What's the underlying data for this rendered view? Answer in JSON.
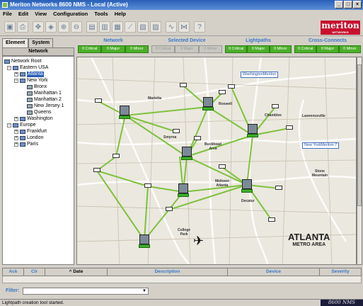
{
  "window": {
    "title": "Meriton Networks 8600 NMS - Local (Active)",
    "min": "_",
    "max": "□",
    "close": "×"
  },
  "menu": [
    "File",
    "Edit",
    "View",
    "Configuration",
    "Tools",
    "Help"
  ],
  "logo": {
    "text": "meriton",
    "sub": "NETWORKS"
  },
  "tabs": [
    "Element",
    "System"
  ],
  "tree": {
    "header": "Network",
    "nodes": [
      {
        "label": "Network Root",
        "level": 0,
        "exp": ""
      },
      {
        "label": "Eastern USA",
        "level": 1,
        "exp": "−"
      },
      {
        "label": "Atlanta",
        "level": 2,
        "exp": "+",
        "selected": true
      },
      {
        "label": "New York",
        "level": 2,
        "exp": "−"
      },
      {
        "label": "Bronx",
        "level": 3,
        "exp": ""
      },
      {
        "label": "Manhattan 1",
        "level": 3,
        "exp": ""
      },
      {
        "label": "Manhattan 2",
        "level": 3,
        "exp": ""
      },
      {
        "label": "New Jersey 1",
        "level": 3,
        "exp": ""
      },
      {
        "label": "Queens",
        "level": 3,
        "exp": ""
      },
      {
        "label": "Washington",
        "level": 2,
        "exp": "+"
      },
      {
        "label": "Europe",
        "level": 1,
        "exp": "−"
      },
      {
        "label": "Frankfurt",
        "level": 2,
        "exp": "+"
      },
      {
        "label": "London",
        "level": 2,
        "exp": "+"
      },
      {
        "label": "Paris",
        "level": 2,
        "exp": "+"
      }
    ]
  },
  "status_panels": [
    {
      "title": "Network",
      "boxes": [
        "0 Critical",
        "0 Major",
        "0 Minor"
      ],
      "gray": false
    },
    {
      "title": "Selected Device",
      "boxes": [
        "0 Critical",
        "0 Major",
        "0 Minor"
      ],
      "gray": true
    },
    {
      "title": "Lightpaths",
      "boxes": [
        "0 Critical",
        "0 Major",
        "0 Minor"
      ],
      "gray": false
    },
    {
      "title": "Cross-Connects",
      "boxes": [
        "0 Critical",
        "0 Major",
        "0 Minor"
      ],
      "gray": false
    }
  ],
  "map": {
    "places": [
      {
        "label": "Marietta"
      },
      {
        "label": "Roswell"
      },
      {
        "label": "Smyrna"
      },
      {
        "label": "Buckhead Area"
      },
      {
        "label": "Chamblee"
      },
      {
        "label": "Lawrenceville"
      },
      {
        "label": "Midtown Atlanta"
      },
      {
        "label": "Decatur"
      },
      {
        "label": "Stone Mountain"
      },
      {
        "label": "College Park"
      }
    ],
    "callouts": [
      "WashingtonMeriton",
      "New YorkMeriton 7"
    ],
    "city": "ATLANTA",
    "city_sub": "METRO AREA"
  },
  "alarm_table": {
    "columns": [
      "Ack",
      "Clr",
      "^ Date",
      "Description",
      "Device",
      "Severity"
    ]
  },
  "filter_label": "Filter:",
  "filter_arrow": "▼",
  "status_text": "Lightpath creation tool started.",
  "version": "8600 NMS",
  "colors": {
    "link": "#7ec23c",
    "accent": "#3a78c8",
    "ok": "#4caf2a"
  }
}
